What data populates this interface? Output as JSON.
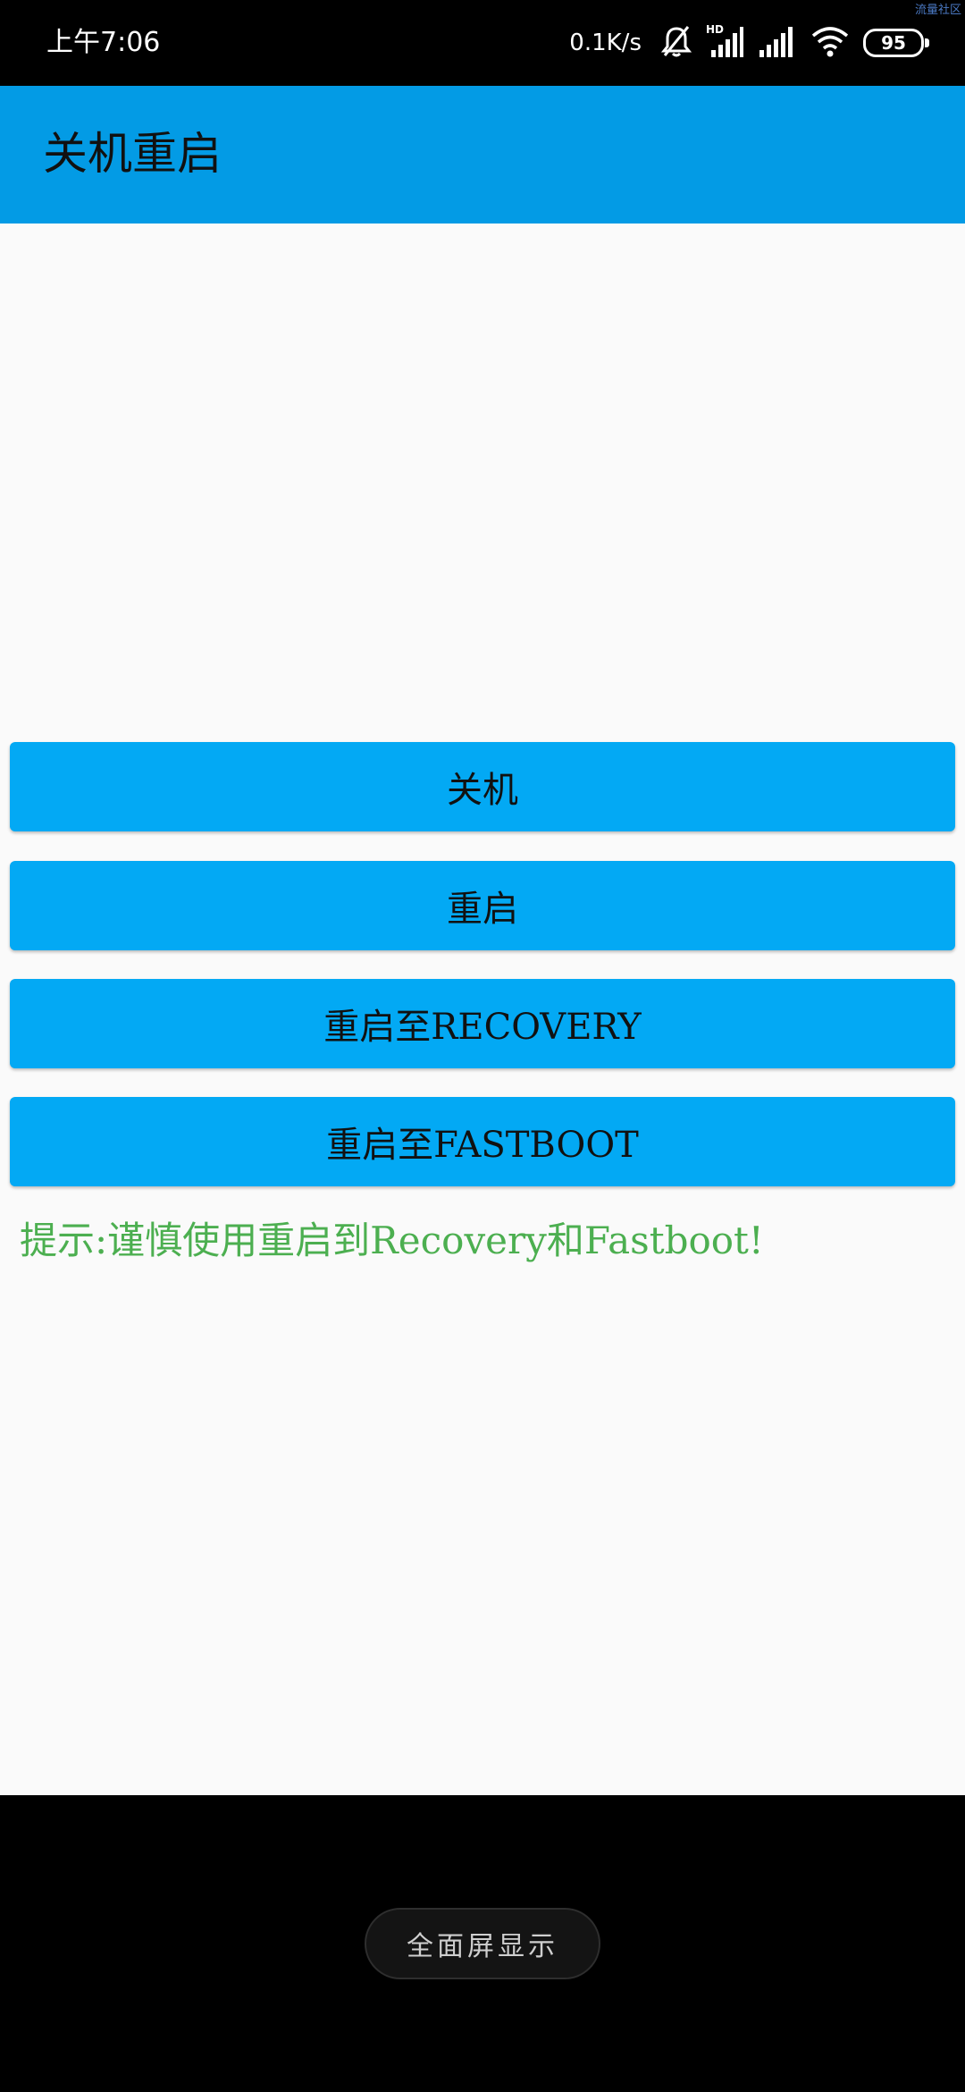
{
  "status_bar": {
    "time": "上午7:06",
    "net_speed": "0.1K/s",
    "battery": "95",
    "icons": [
      "mute-bell-icon",
      "hd-signal-icon",
      "signal-icon",
      "wifi-icon",
      "battery-icon"
    ]
  },
  "watermark": "流量社区",
  "app_bar": {
    "title": "关机重启",
    "color": "#039be5"
  },
  "buttons": {
    "shutdown": "关机",
    "reboot": "重启",
    "reboot_recovery": "重启至RECOVERY",
    "reboot_fastboot": "重启至FASTBOOT",
    "color": "#03a9f4"
  },
  "hint": {
    "text": "提示:谨慎使用重启到Recovery和Fastboot!",
    "color": "#4caf50"
  },
  "bottom": {
    "fullscreen_label": "全面屏显示"
  }
}
